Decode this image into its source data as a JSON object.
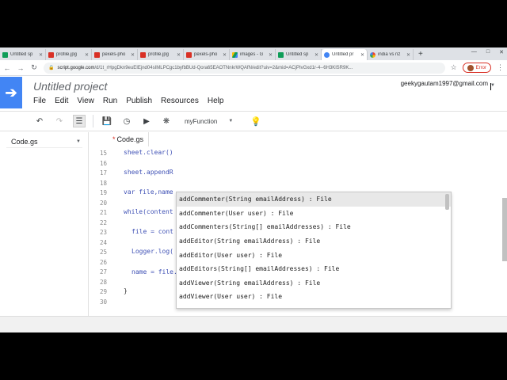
{
  "browser": {
    "tabs": [
      {
        "label": "Untitled sp",
        "icon": "sheets"
      },
      {
        "label": "profile.jpg",
        "icon": "photos"
      },
      {
        "label": "pexels-pho",
        "icon": "photos"
      },
      {
        "label": "profile.jpg",
        "icon": "photos"
      },
      {
        "label": "pexels-pho",
        "icon": "photos"
      },
      {
        "label": "images - G",
        "icon": "drive"
      },
      {
        "label": "Untitled sp",
        "icon": "sheets"
      },
      {
        "label": "Untitled pr",
        "icon": "script"
      },
      {
        "label": "india vs nz",
        "icon": "google"
      }
    ],
    "new_tab": "+",
    "url_host": "script.google.com",
    "url_path": "/d/1t_rHpgDkn9euEIEjnd04sIMLPCgc1byfbBUd-Qora65EAOTNnkrWQAfN/edit?uiv=2&mid=ACjPIvGxd1r-4--6H3KlSR9K...",
    "error_label": "Error"
  },
  "app": {
    "project_title": "Untitled project",
    "menu": [
      "File",
      "Edit",
      "View",
      "Run",
      "Publish",
      "Resources",
      "Help"
    ],
    "account": "geekygautam1997@gmail.com",
    "function_selector": "myFunction"
  },
  "files": {
    "current": "Code.gs"
  },
  "editor": {
    "tab_label": "Code.gs",
    "tab_modified": "*",
    "line_numbers": [
      "15",
      "16",
      "17",
      "18",
      "19",
      "20",
      "21",
      "22",
      "23",
      "24",
      "25",
      "26",
      "27",
      "28",
      "29",
      "30"
    ],
    "code_lines": [
      {
        "line": "15",
        "text": "sheet.clear()",
        "indent": 0
      },
      {
        "line": "17",
        "text": "sheet.appendR",
        "indent": 0
      },
      {
        "line": "19",
        "text": "var file,name",
        "indent": 0
      },
      {
        "line": "21",
        "text": "while(content",
        "indent": 0
      },
      {
        "line": "23",
        "text": "file = cont",
        "indent": 1
      },
      {
        "line": "25",
        "text": "Logger.log(",
        "indent": 1
      },
      {
        "line": "27",
        "text": "name = file.",
        "indent": 1
      },
      {
        "line": "29",
        "text": "}",
        "indent": 0
      }
    ]
  },
  "autocomplete": {
    "items": [
      "addCommenter(String emailAddress) : File",
      "addCommenter(User user) : File",
      "addCommenters(String[] emailAddresses) : File",
      "addEditor(String emailAddress) : File",
      "addEditor(User user) : File",
      "addEditors(String[] emailAddresses) : File",
      "addViewer(String emailAddress) : File",
      "addViewer(User user) : File"
    ],
    "selected_index": 0
  }
}
